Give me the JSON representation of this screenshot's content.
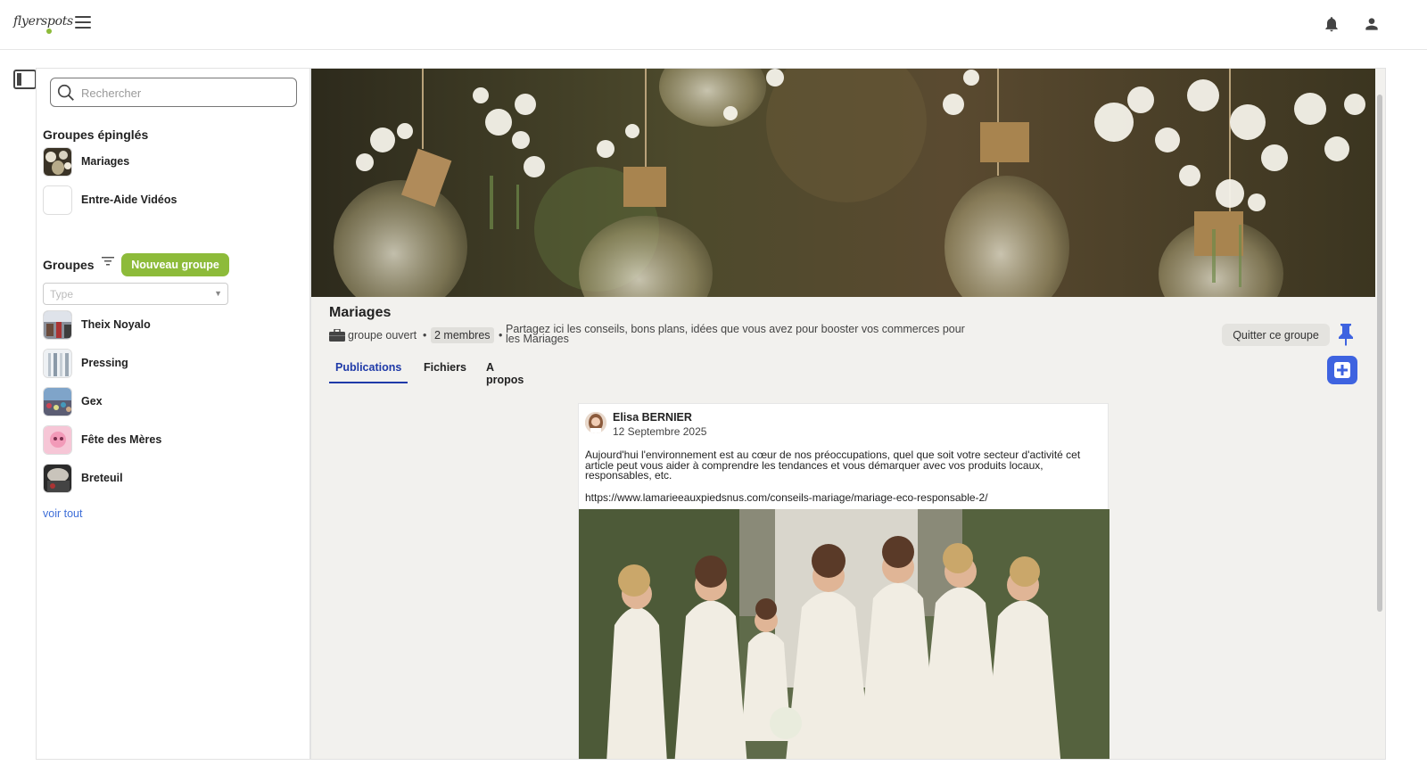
{
  "app": {
    "logo_text": "flyerspots"
  },
  "search": {
    "placeholder": "Rechercher"
  },
  "pinned": {
    "title": "Groupes épinglés",
    "items": [
      {
        "label": "Mariages"
      },
      {
        "label": "Entre-Aide Vidéos"
      }
    ]
  },
  "groups": {
    "title": "Groupes",
    "new_button": "Nouveau groupe",
    "type_placeholder": "Type",
    "items": [
      {
        "label": "Theix Noyalo"
      },
      {
        "label": "Pressing"
      },
      {
        "label": "Gex"
      },
      {
        "label": "Fête des Mères"
      },
      {
        "label": "Breteuil"
      }
    ],
    "see_all": "voir tout"
  },
  "group": {
    "title": "Mariages",
    "visibility": "groupe ouvert",
    "members": "2 membres",
    "description": "Partagez ici les conseils, bons plans, idées que vous avez pour booster vos commerces pour les Mariages",
    "quit_button": "Quitter ce groupe",
    "tabs": [
      {
        "label": "Publications",
        "active": true
      },
      {
        "label": "Fichiers",
        "active": false
      },
      {
        "label": "A propos",
        "active": false
      }
    ]
  },
  "post": {
    "author": "Elisa BERNIER",
    "date": "12 Septembre 2025",
    "body": "Aujourd'hui l'environnement est au cœur de nos préoccupations, quel que soit votre secteur d'activité cet article peut vous aider à comprendre les tendances et vous démarquer avec vos produits locaux, responsables, etc.",
    "link": "https://www.lamarieeauxpiedsnus.com/conseils-mariage/mariage-eco-responsable-2/"
  },
  "colors": {
    "accent_green": "#8dbb3a",
    "accent_blue": "#3e63e0",
    "tab_active": "#1f3aa8",
    "link": "#3f6fd8"
  },
  "icons": [
    "hamburger-icon",
    "bell-icon",
    "user-icon",
    "sidebar-toggle-icon",
    "search-icon",
    "filter-icon",
    "briefcase-icon",
    "pin-icon",
    "plus-square-icon"
  ]
}
